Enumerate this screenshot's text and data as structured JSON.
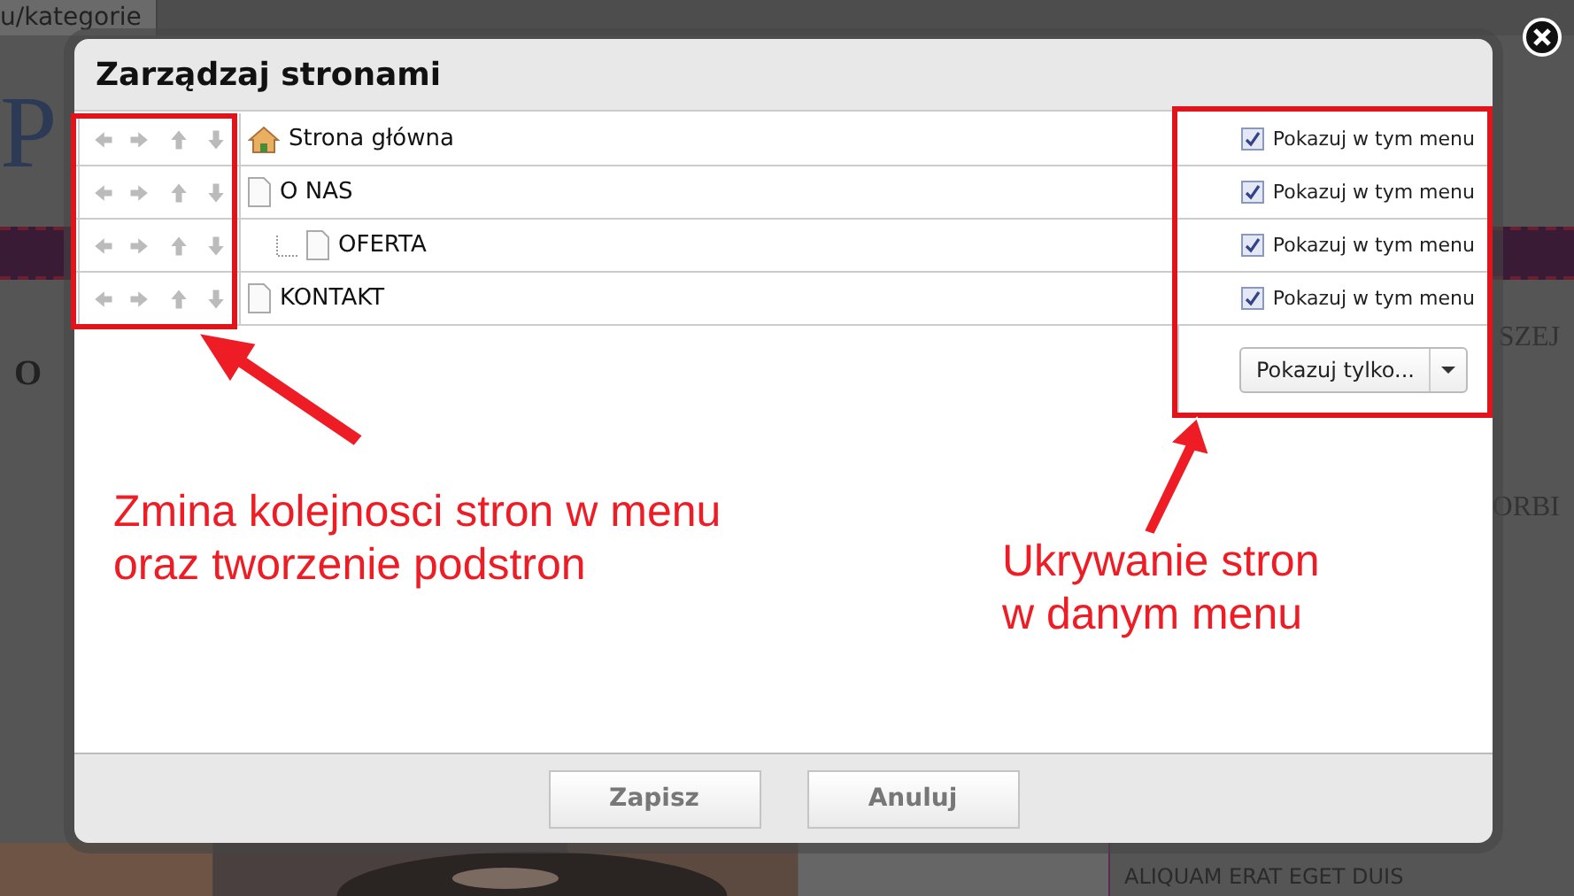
{
  "background": {
    "tab": "u/kategorie",
    "logo": "P",
    "heading": "O",
    "sidebar_texts": [
      "SZEJ",
      "ORBI"
    ],
    "sidebar_footer": "ALIQUAM ERAT EGET DUIS"
  },
  "dialog": {
    "title": "Zarządzaj stronami",
    "pages": [
      {
        "name": "Strona główna",
        "kind": "home",
        "menu_label": "Pokazuj w tym menu",
        "checked": true
      },
      {
        "name": "O NAS",
        "kind": "page",
        "menu_label": "Pokazuj w tym menu",
        "checked": true,
        "children": [
          {
            "name": "OFERTA",
            "kind": "page",
            "menu_label": "Pokazuj w tym menu",
            "checked": true
          }
        ]
      },
      {
        "name": "KONTAKT",
        "kind": "page",
        "menu_label": "Pokazuj w tym menu",
        "checked": true
      }
    ],
    "filter": "Pokazuj tylko...",
    "buttons": [
      "Zapisz",
      "Anuluj"
    ]
  },
  "annotations": [
    {
      "lines": [
        "Zmina kolejnosci stron w menu",
        "oraz tworzenie podstron"
      ]
    },
    {
      "lines": [
        "Ukrywanie stron",
        "w danym menu"
      ]
    }
  ]
}
